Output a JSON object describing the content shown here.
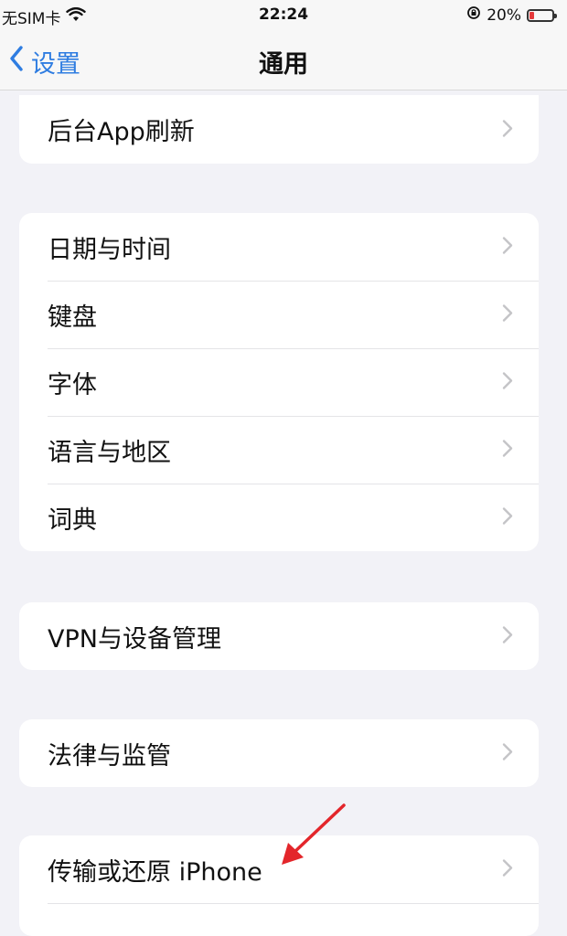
{
  "status_bar": {
    "carrier": "无SIM卡",
    "time": "22:24",
    "battery_percent": "20%",
    "battery_level": 0.2,
    "icons": [
      "wifi-icon",
      "orientation-lock-icon",
      "battery-icon"
    ]
  },
  "nav": {
    "back_label": "设置",
    "title": "通用"
  },
  "groups": [
    {
      "items": [
        "后台App刷新"
      ]
    },
    {
      "items": [
        "日期与时间",
        "键盘",
        "字体",
        "语言与地区",
        "词典"
      ]
    },
    {
      "items": [
        "VPN与设备管理"
      ]
    },
    {
      "items": [
        "法律与监管"
      ]
    },
    {
      "items": [
        "传输或还原 iPhone"
      ]
    }
  ],
  "annotation": {
    "arrow_color": "#e3262b",
    "target": "传输或还原 iPhone"
  },
  "colors": {
    "accent": "#2f7de1",
    "background": "#f2f2f7",
    "chevron": "#c4c4c7"
  }
}
